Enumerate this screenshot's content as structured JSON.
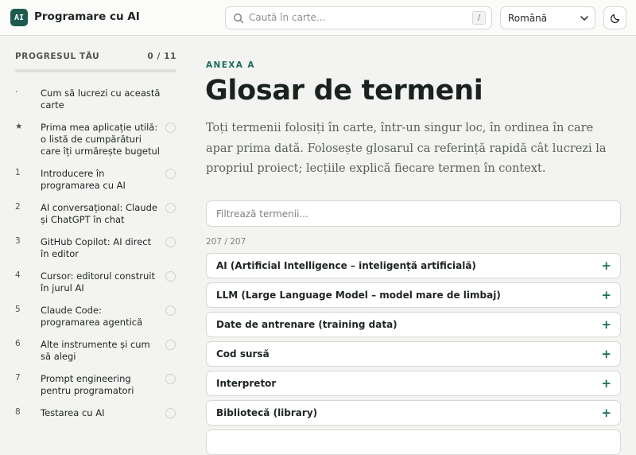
{
  "header": {
    "logo_text": "AI",
    "brand": "Programare cu AI",
    "search_placeholder": "Caută în carte...",
    "search_shortcut": "/",
    "language": "Română",
    "theme_icon": "moon-icon"
  },
  "sidebar": {
    "progress_label": "PROGRESUL TĂU",
    "progress_count": "0 / 11",
    "progress_fraction": 0,
    "items": [
      {
        "num": "·",
        "label": "Cum să lucrezi cu această carte",
        "has_circle": false
      },
      {
        "num": "★",
        "label": "Prima mea aplicație utilă: o listă de cumpărături care îți urmărește bugetul",
        "has_circle": true
      },
      {
        "num": "1",
        "label": "Introducere în programarea cu AI",
        "has_circle": true
      },
      {
        "num": "2",
        "label": "AI conversațional: Claude și ChatGPT în chat",
        "has_circle": true
      },
      {
        "num": "3",
        "label": "GitHub Copilot: AI direct în editor",
        "has_circle": true
      },
      {
        "num": "4",
        "label": "Cursor: editorul construit în jurul AI",
        "has_circle": true
      },
      {
        "num": "5",
        "label": "Claude Code: programarea agentică",
        "has_circle": true
      },
      {
        "num": "6",
        "label": "Alte instrumente și cum să alegi",
        "has_circle": true
      },
      {
        "num": "7",
        "label": "Prompt engineering pentru programatori",
        "has_circle": true
      },
      {
        "num": "8",
        "label": "Testarea cu AI",
        "has_circle": true
      }
    ]
  },
  "main": {
    "eyebrow": "ANEXA A",
    "title": "Glosar de termeni",
    "lead": "Toți termenii folosiți în carte, într-un singur loc, în ordinea în care apar prima dată. Folosește glosarul ca referință rapidă cât lucrezi la propriul proiect; lecțiile explică fiecare termen în context.",
    "filter_placeholder": "Filtrează termenii...",
    "counter": "207 / 207",
    "terms": [
      "AI (Artificial Intelligence – inteligență artificială)",
      "LLM (Large Language Model – model mare de limbaj)",
      "Date de antrenare (training data)",
      "Cod sursă",
      "Interpretor",
      "Bibliotecă (library)"
    ],
    "expand_symbol": "+"
  },
  "colors": {
    "accent": "#1d5b50",
    "accent_text": "#1d6b5d",
    "background": "#f3f4f1"
  }
}
